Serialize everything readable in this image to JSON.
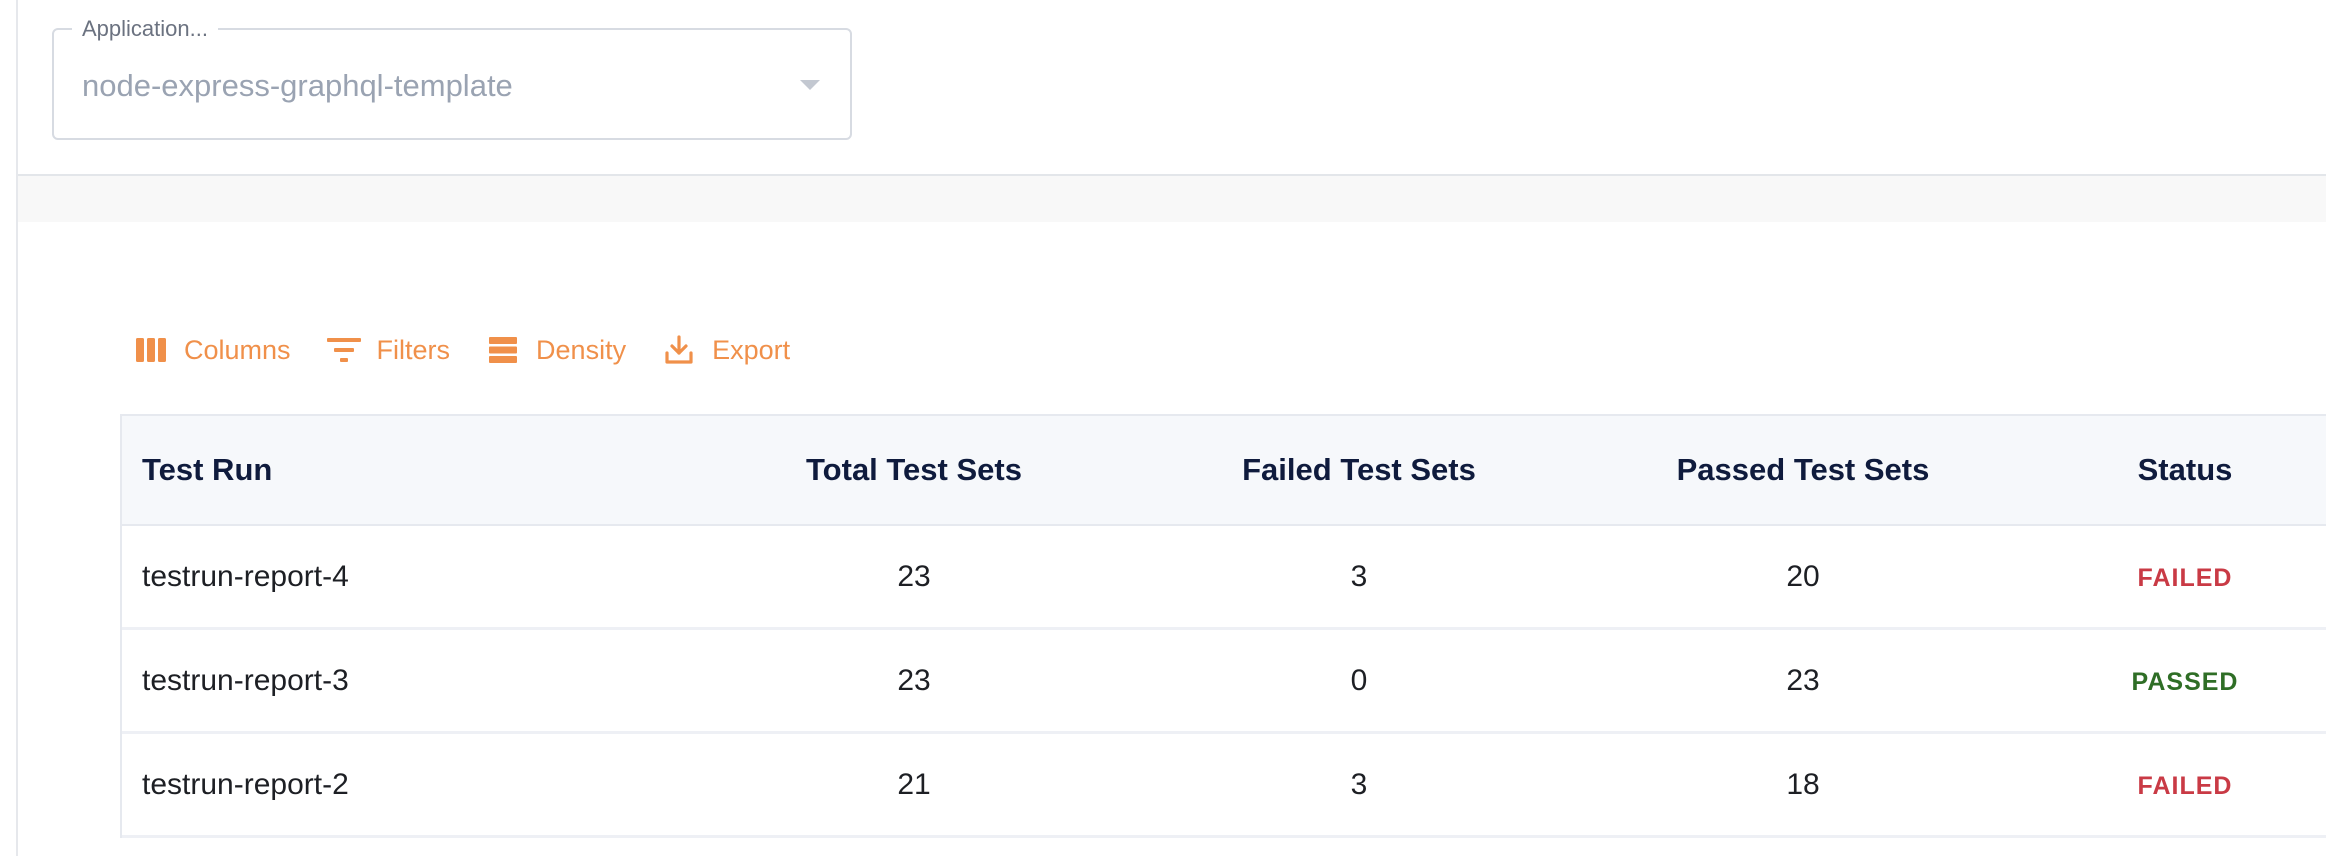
{
  "app_select": {
    "legend": "Application...",
    "value": "node-express-graphql-template"
  },
  "toolbar": {
    "columns_label": "Columns",
    "filters_label": "Filters",
    "density_label": "Density",
    "export_label": "Export",
    "accent_color": "#f0904a"
  },
  "table": {
    "headers": [
      "Test Run",
      "Total Test Sets",
      "Failed Test Sets",
      "Passed Test Sets",
      "Status"
    ],
    "rows": [
      {
        "test_run": "testrun-report-4",
        "total": "23",
        "failed": "3",
        "passed": "20",
        "status": "FAILED"
      },
      {
        "test_run": "testrun-report-3",
        "total": "23",
        "failed": "0",
        "passed": "23",
        "status": "PASSED"
      },
      {
        "test_run": "testrun-report-2",
        "total": "21",
        "failed": "3",
        "passed": "18",
        "status": "FAILED"
      }
    ]
  },
  "status_colors": {
    "failed": "#c93a45",
    "passed": "#2f6e26"
  }
}
